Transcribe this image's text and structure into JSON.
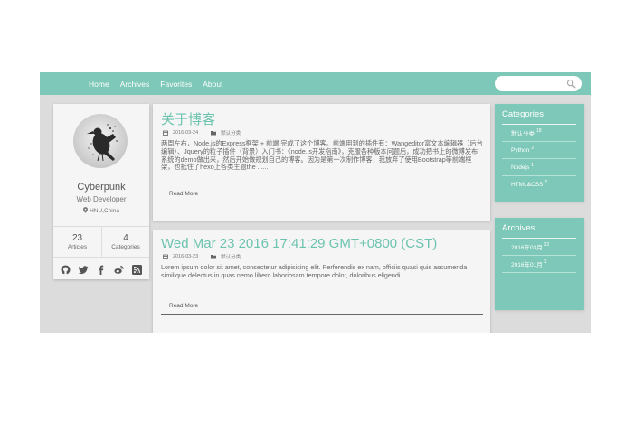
{
  "nav": {
    "items": [
      "Home",
      "Archives",
      "Favorites",
      "About"
    ],
    "search_placeholder": ""
  },
  "profile": {
    "name": "Cyberpunk",
    "role": "Web Developer",
    "location": "HNU,China",
    "stats": [
      {
        "num": "23",
        "label": "Articles"
      },
      {
        "num": "4",
        "label": "Categories"
      }
    ],
    "social_icons": [
      "github-icon",
      "twitter-icon",
      "facebook-icon",
      "weibo-icon",
      "rss-icon"
    ]
  },
  "posts": [
    {
      "title": "关于博客",
      "date": "2016-03-24",
      "category": "默认分类",
      "excerpt": "两周左右，Node.js的Express框架 + 前端 完成了这个博客。前端用到的插件有：Wangeditor富文本编辑器（后台编辑）、Jquery的粒子插件（背景）入门书：《node.js开发指南》，克服各种版本问题后，成功把书上的微博发布系统的demo做出来，然后开始做规划自己的博客。因为是第一次制作博客，我放弃了使用Bootstrap等前端框架，也抵住了hexo上各类主题the ......",
      "read_more": "Read More"
    },
    {
      "title": "Wed Mar 23 2016 17:41:29 GMT+0800 (CST)",
      "date": "2016-03-23",
      "category": "默认分类",
      "excerpt": "Lorem ipsum dolor sit amet, consectetur adipisicing elit. Perferendis ex nam, officiis quasi quis assumenda similique delectus in quas nemo libero laboriosam tempore dolor, doloribus eligendi ......",
      "read_more": "Read More"
    }
  ],
  "categories": {
    "title": "Categories",
    "items": [
      {
        "label": "默认分类",
        "count": "18"
      },
      {
        "label": "Python",
        "count": "2"
      },
      {
        "label": "Nodejs",
        "count": "1"
      },
      {
        "label": "HTML&CSS",
        "count": "2"
      }
    ]
  },
  "archives": {
    "title": "Archives",
    "items": [
      {
        "label": "2016年03月",
        "count": "22"
      },
      {
        "label": "2016年01月",
        "count": "1"
      }
    ]
  },
  "colors": {
    "accent": "#7dc8b8",
    "title": "#6cc3ae",
    "background": "#dcdcdc",
    "card": "#f5f5f5"
  }
}
